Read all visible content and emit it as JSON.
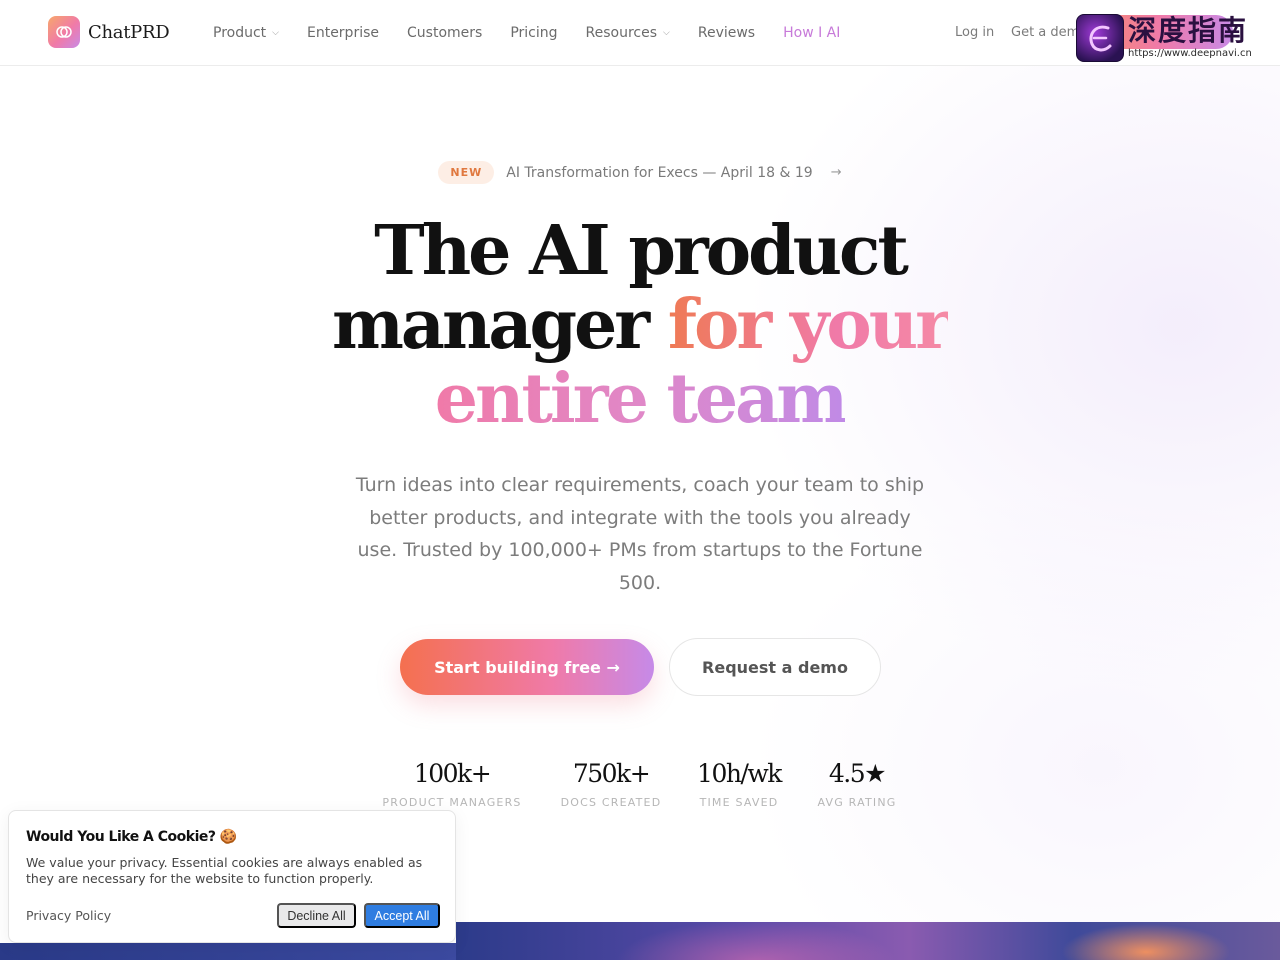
{
  "nav": {
    "brand": "ChatPRD",
    "links": [
      {
        "label": "Product",
        "dropdown": true
      },
      {
        "label": "Enterprise",
        "dropdown": false
      },
      {
        "label": "Customers",
        "dropdown": false
      },
      {
        "label": "Pricing",
        "dropdown": false
      },
      {
        "label": "Resources",
        "dropdown": true
      },
      {
        "label": "Reviews",
        "dropdown": false
      },
      {
        "label": "How I AI",
        "dropdown": false
      }
    ],
    "login": "Log in",
    "get_demo": "Get a dem"
  },
  "watermark": {
    "cn": "深度指南",
    "url": "https://www.deepnavi.cn"
  },
  "hero": {
    "badge_new": "NEW",
    "badge_text": "AI Transformation for Execs — April 18 & 19",
    "badge_arrow": "→",
    "headline_1": "The AI product",
    "headline_2a": "manager ",
    "headline_2b": "for your",
    "headline_3": "entire team",
    "subtext": "Turn ideas into clear requirements, coach your team to ship better products, and integrate with the tools you already use. Trusted by 100,000+ PMs from startups to the Fortune 500.",
    "cta_primary": "Start building free →",
    "cta_secondary": "Request a demo"
  },
  "stats": [
    {
      "value": "100k+",
      "label": "PRODUCT MANAGERS"
    },
    {
      "value": "750k+",
      "label": "DOCS CREATED"
    },
    {
      "value": "10h/wk",
      "label": "TIME SAVED"
    },
    {
      "value": "4.5★",
      "label": "AVG RATING"
    }
  ],
  "cookie": {
    "title": "Would You Like A Cookie? 🍪",
    "body": "We value your privacy. Essential cookies are always enabled as they are necessary for the website to function properly.",
    "policy": "Privacy Policy",
    "decline": "Decline All",
    "accept": "Accept All"
  },
  "colors": {
    "accent_active": "#c77ad9",
    "gradient_start": "#f4704f",
    "gradient_mid": "#f07aa8",
    "gradient_end": "#c68ae8",
    "accept_blue": "#2f7de1"
  }
}
